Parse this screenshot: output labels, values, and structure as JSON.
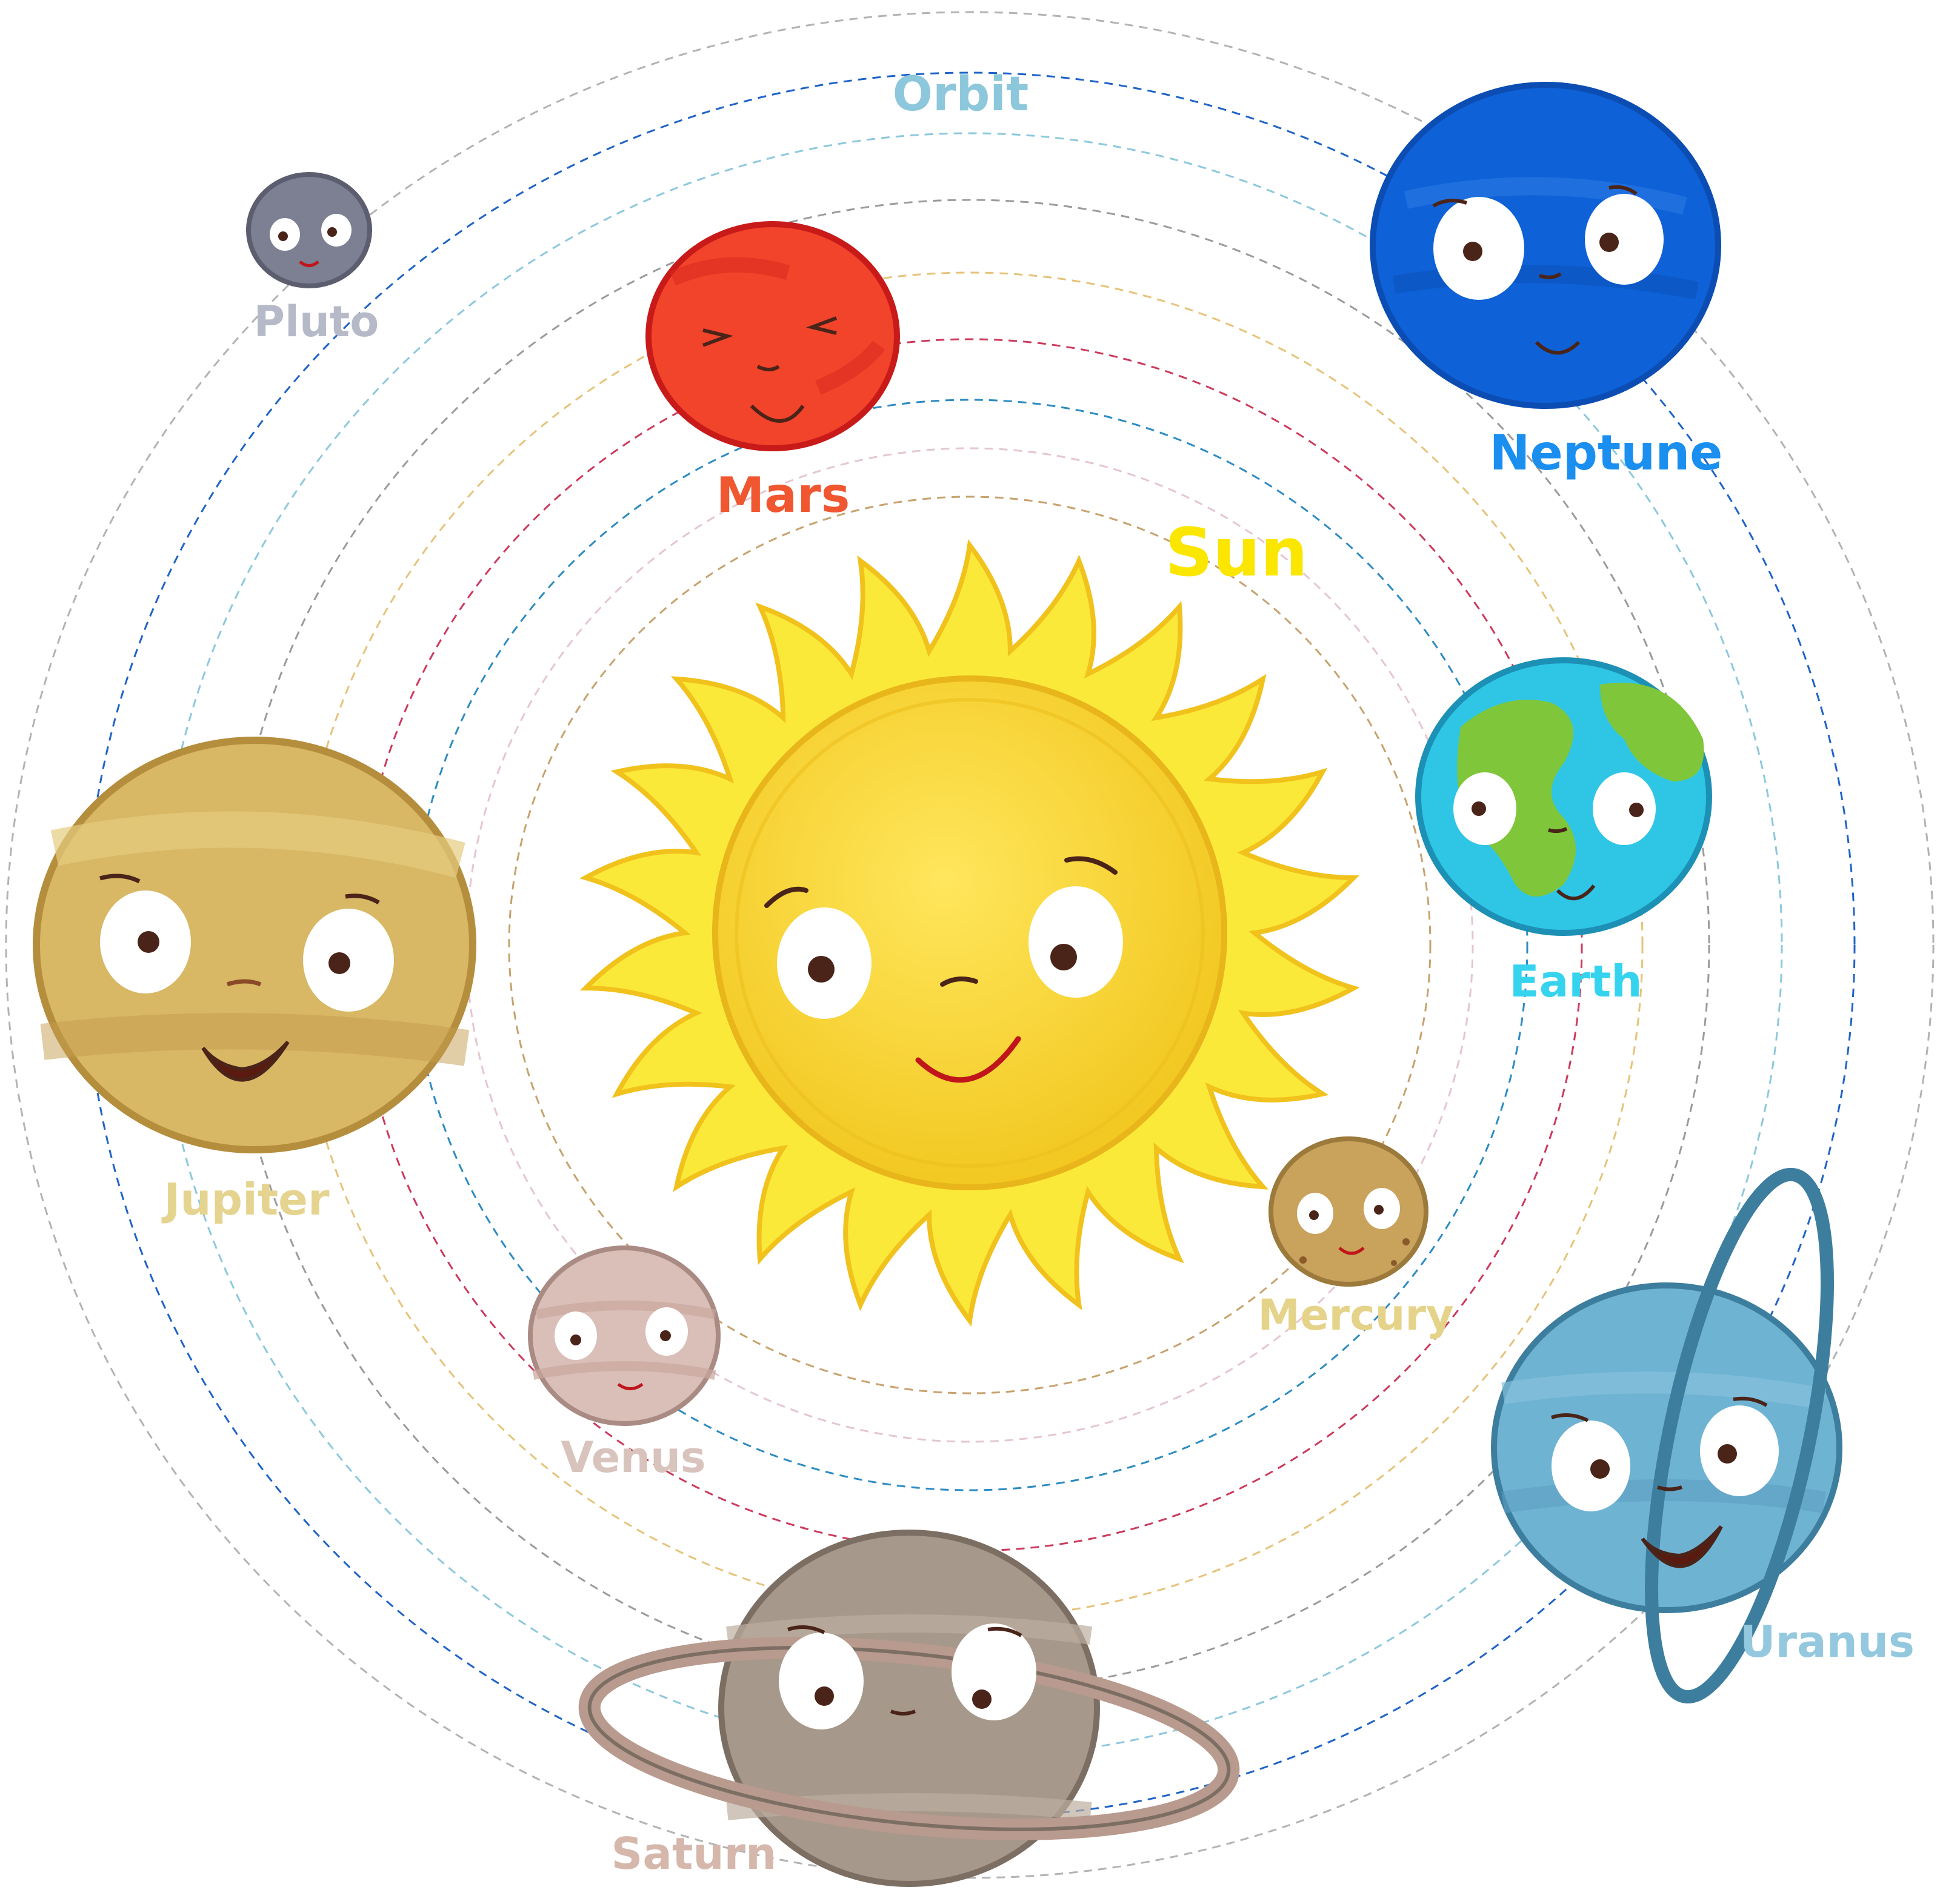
{
  "title": "Orbit",
  "center": "Sun",
  "bodies": [
    {
      "name": "Mercury",
      "color": "#c9a25c",
      "label_color": "#e6d38a"
    },
    {
      "name": "Venus",
      "color": "#d9bfb8",
      "label_color": "#d8c3bd"
    },
    {
      "name": "Earth",
      "color": "#2fc6e6",
      "label_color": "#35d3ee"
    },
    {
      "name": "Mars",
      "color": "#f2432b",
      "label_color": "#f0562f"
    },
    {
      "name": "Jupiter",
      "color": "#d8b765",
      "label_color": "#e5d48f"
    },
    {
      "name": "Saturn",
      "color": "#a6988a",
      "label_color": "#d6b7ac"
    },
    {
      "name": "Uranus",
      "color": "#6fb3d3",
      "label_color": "#93c8df"
    },
    {
      "name": "Neptune",
      "color": "#0e61d6",
      "label_color": "#1a8ff0"
    },
    {
      "name": "Pluto",
      "color": "#7d7f93",
      "label_color": "#b6bac8"
    }
  ],
  "colors": {
    "sun_label": "#fbe600",
    "orbit_label": "#8cc7dc",
    "sun_rays": "#fbe93a",
    "sun_core": "#f6d634"
  }
}
